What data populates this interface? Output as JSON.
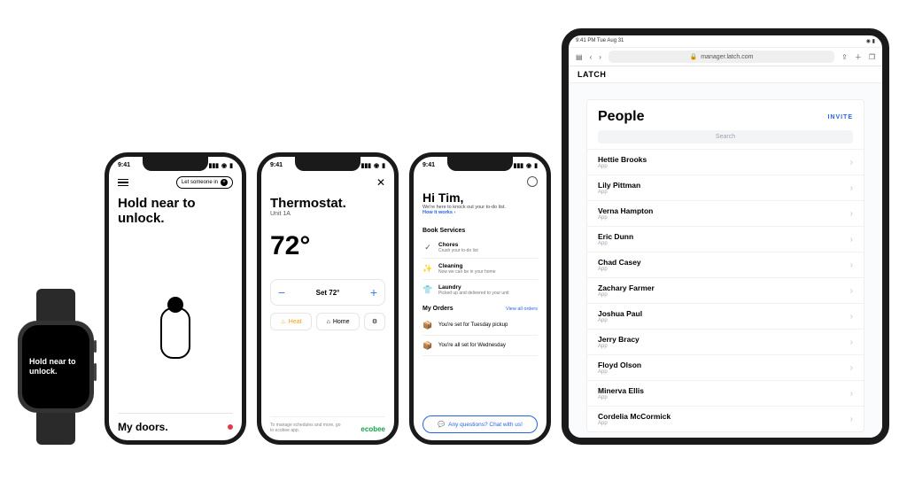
{
  "watch": {
    "text": "Hold near to unlock."
  },
  "phone_status": {
    "time": "9:41"
  },
  "phone1": {
    "let_someone_in": "Let someone in",
    "title": "Hold near to unlock.",
    "footer": "My doors."
  },
  "phone2": {
    "title": "Thermostat.",
    "unit": "Unit 1A",
    "temp": "72°",
    "set_label": "Set 72°",
    "heat": "Heat",
    "home": "Home",
    "note": "To manage schedules and more, go to ecobee app.",
    "brand": "ecobee"
  },
  "phone3": {
    "greet": "Hi Tim,",
    "sub": "We're here to knock out your to-do list.",
    "how": "How it works ›",
    "book": "Book Services",
    "services": [
      {
        "icon": "✓",
        "t": "Chores",
        "d": "Crush your to-do list"
      },
      {
        "icon": "✨",
        "t": "Cleaning",
        "d": "Now we can be in your home"
      },
      {
        "icon": "👕",
        "t": "Laundry",
        "d": "Picked up and delivered to your unit"
      }
    ],
    "orders_title": "My Orders",
    "view_all": "View all orders",
    "orders": [
      {
        "icon": "📦",
        "t": "You're set for Tuesday pickup"
      },
      {
        "icon": "📦",
        "t": "You're all set for Wednesday"
      }
    ],
    "chat": "Any questions? Chat with us!"
  },
  "ipad": {
    "status_left": "9:41 PM  Tue Aug 31",
    "url": "manager.latch.com",
    "brand": "LATCH",
    "people_title": "People",
    "invite": "INVITE",
    "search": "Search",
    "role": "App",
    "people": [
      "Hettie Brooks",
      "Lily Pittman",
      "Verna Hampton",
      "Eric Dunn",
      "Chad Casey",
      "Zachary Farmer",
      "Joshua Paul",
      "Jerry Bracy",
      "Floyd Olson",
      "Minerva Ellis",
      "Cordelia McCormick"
    ]
  }
}
